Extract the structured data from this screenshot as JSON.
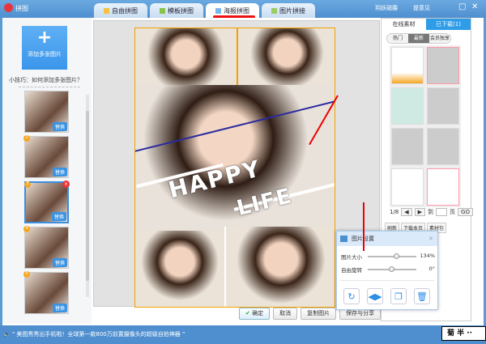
{
  "app": {
    "title": "拼图",
    "user": "玥妖磁霾",
    "feedback": "提意见"
  },
  "tabs": [
    {
      "label": "自由拼图"
    },
    {
      "label": "模板拼图"
    },
    {
      "label": "海报拼图"
    },
    {
      "label": "图片拼接"
    }
  ],
  "left": {
    "add_label": "添加多张图片",
    "tip": "小技巧：如何添加多张图片？",
    "replace": "替换",
    "thumb_numbers": [
      "2",
      "3",
      "4",
      "5"
    ]
  },
  "poster": {
    "line1": "HAPPY",
    "line2": "LIFE"
  },
  "buttons": {
    "ok": "确定",
    "cancel": "取消",
    "copy": "复制图片",
    "save": "保存与分享"
  },
  "right": {
    "tab_online": "在线素材",
    "tab_downloaded": "已下载(1)",
    "filters": [
      "热门",
      "最新",
      "会员独享"
    ],
    "page": "1/8",
    "goto": "到",
    "page_unit": "页",
    "go": "GO",
    "refresh": "刷新",
    "download_page": "下载本页",
    "pack": "素材包"
  },
  "dialog": {
    "title": "图片设置",
    "size_label": "图片大小",
    "size_value": "134%",
    "size_fraction": 0.6,
    "rotate_label": "自由旋转",
    "rotate_value": "0°",
    "rotate_fraction": 0.5
  },
  "status": {
    "text": "\" 美图秀秀出手机啦！全球第一款800万前置摄像头的超级自拍神器 \""
  },
  "brand": "菊 半 ··"
}
